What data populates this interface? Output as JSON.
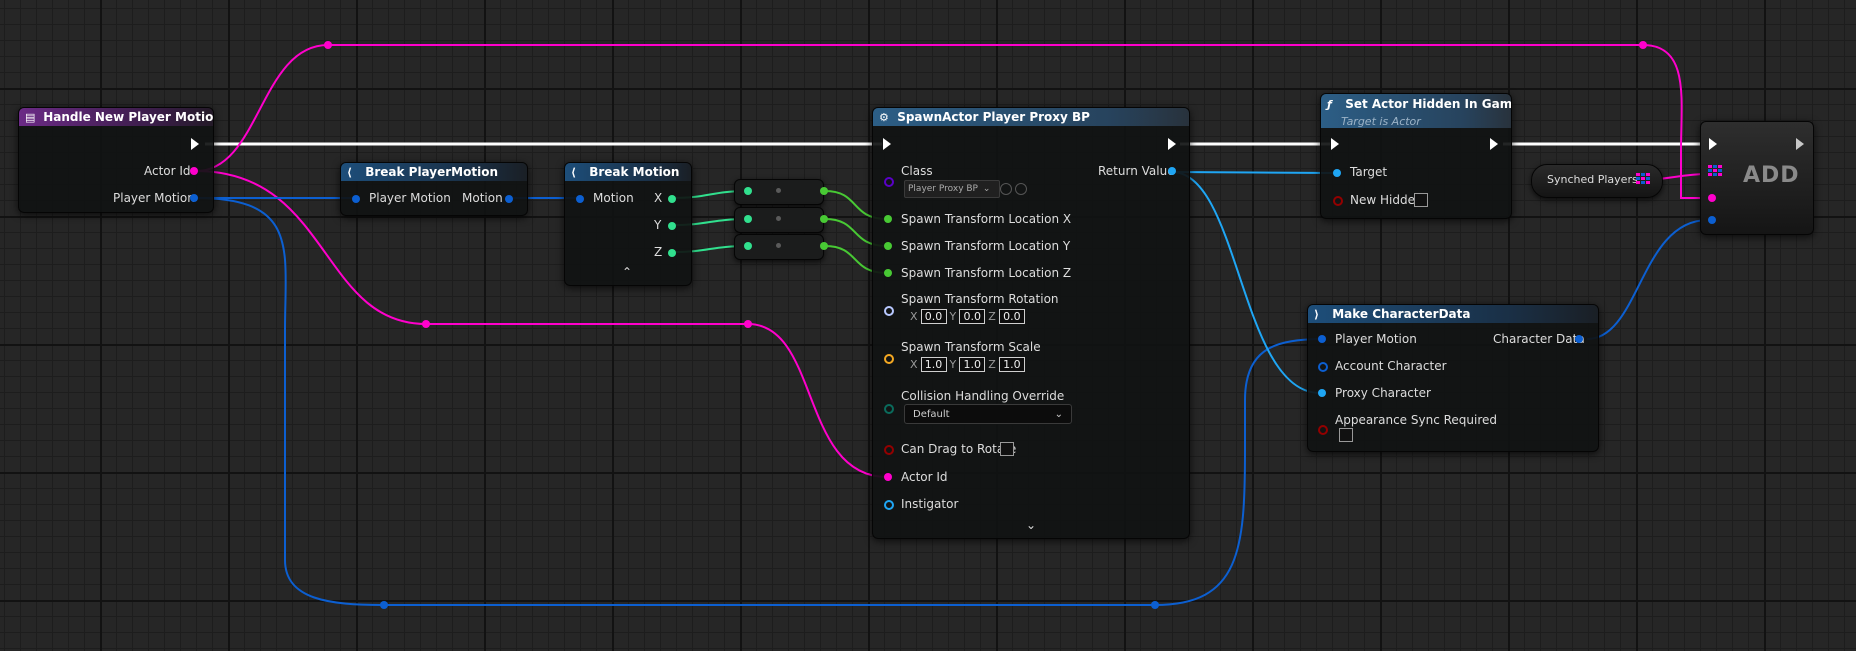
{
  "nodes": {
    "handle_new_player_motion": {
      "title": "Handle New Player Motion",
      "pins": {
        "actor_id": "Actor Id",
        "player_motion": "Player Motion"
      }
    },
    "break_player_motion": {
      "title": "Break PlayerMotion",
      "pins": {
        "player_motion": "Player Motion",
        "motion": "Motion"
      }
    },
    "break_motion": {
      "title": "Break Motion",
      "pins": {
        "motion": "Motion",
        "x": "X",
        "y": "Y",
        "z": "Z"
      }
    },
    "spawn_actor": {
      "title": "SpawnActor Player Proxy BP",
      "pins": {
        "class": "Class",
        "class_value": "Player Proxy BP",
        "return_value": "Return Value",
        "loc_x": "Spawn Transform Location X",
        "loc_y": "Spawn Transform Location Y",
        "loc_z": "Spawn Transform Location Z",
        "rotation": "Spawn Transform Rotation",
        "scale": "Spawn Transform Scale",
        "collision": "Collision Handling Override",
        "collision_value": "Default",
        "can_drag": "Can Drag to Rotate",
        "actor_id": "Actor Id",
        "instigator": "Instigator"
      },
      "rotation_values": {
        "x": "0.0",
        "y": "0.0",
        "z": "0.0"
      },
      "scale_values": {
        "x": "1.0",
        "y": "1.0",
        "z": "1.0"
      },
      "axis_labels": {
        "x": "X",
        "y": "Y",
        "z": "Z"
      }
    },
    "set_actor_hidden": {
      "title": "Set Actor Hidden In Game",
      "subtitle": "Target is Actor",
      "pins": {
        "target": "Target",
        "new_hidden": "New Hidden"
      }
    },
    "synched_players": {
      "label": "Synched Players"
    },
    "add": {
      "label": "ADD"
    },
    "make_character_data": {
      "title": "Make CharacterData",
      "pins": {
        "player_motion": "Player Motion",
        "account_character": "Account Character",
        "proxy_character": "Proxy Character",
        "appearance_sync": "Appearance Sync Required",
        "character_data": "Character Data"
      }
    }
  },
  "colors": {
    "exec": "#ffffff",
    "integer_pin": "#ff00cc",
    "struct_pin": "#0c5fd1",
    "float_pin": "#31e08e",
    "float_wire": "#48c934",
    "object_pin": "#1fa6f4",
    "class_pin": "#5a00c8",
    "vector_pin": "#b8c8ff",
    "transform_pin": "#f4a822",
    "enum_pin": "#0a6b5c",
    "bool_pin": "#930000"
  }
}
